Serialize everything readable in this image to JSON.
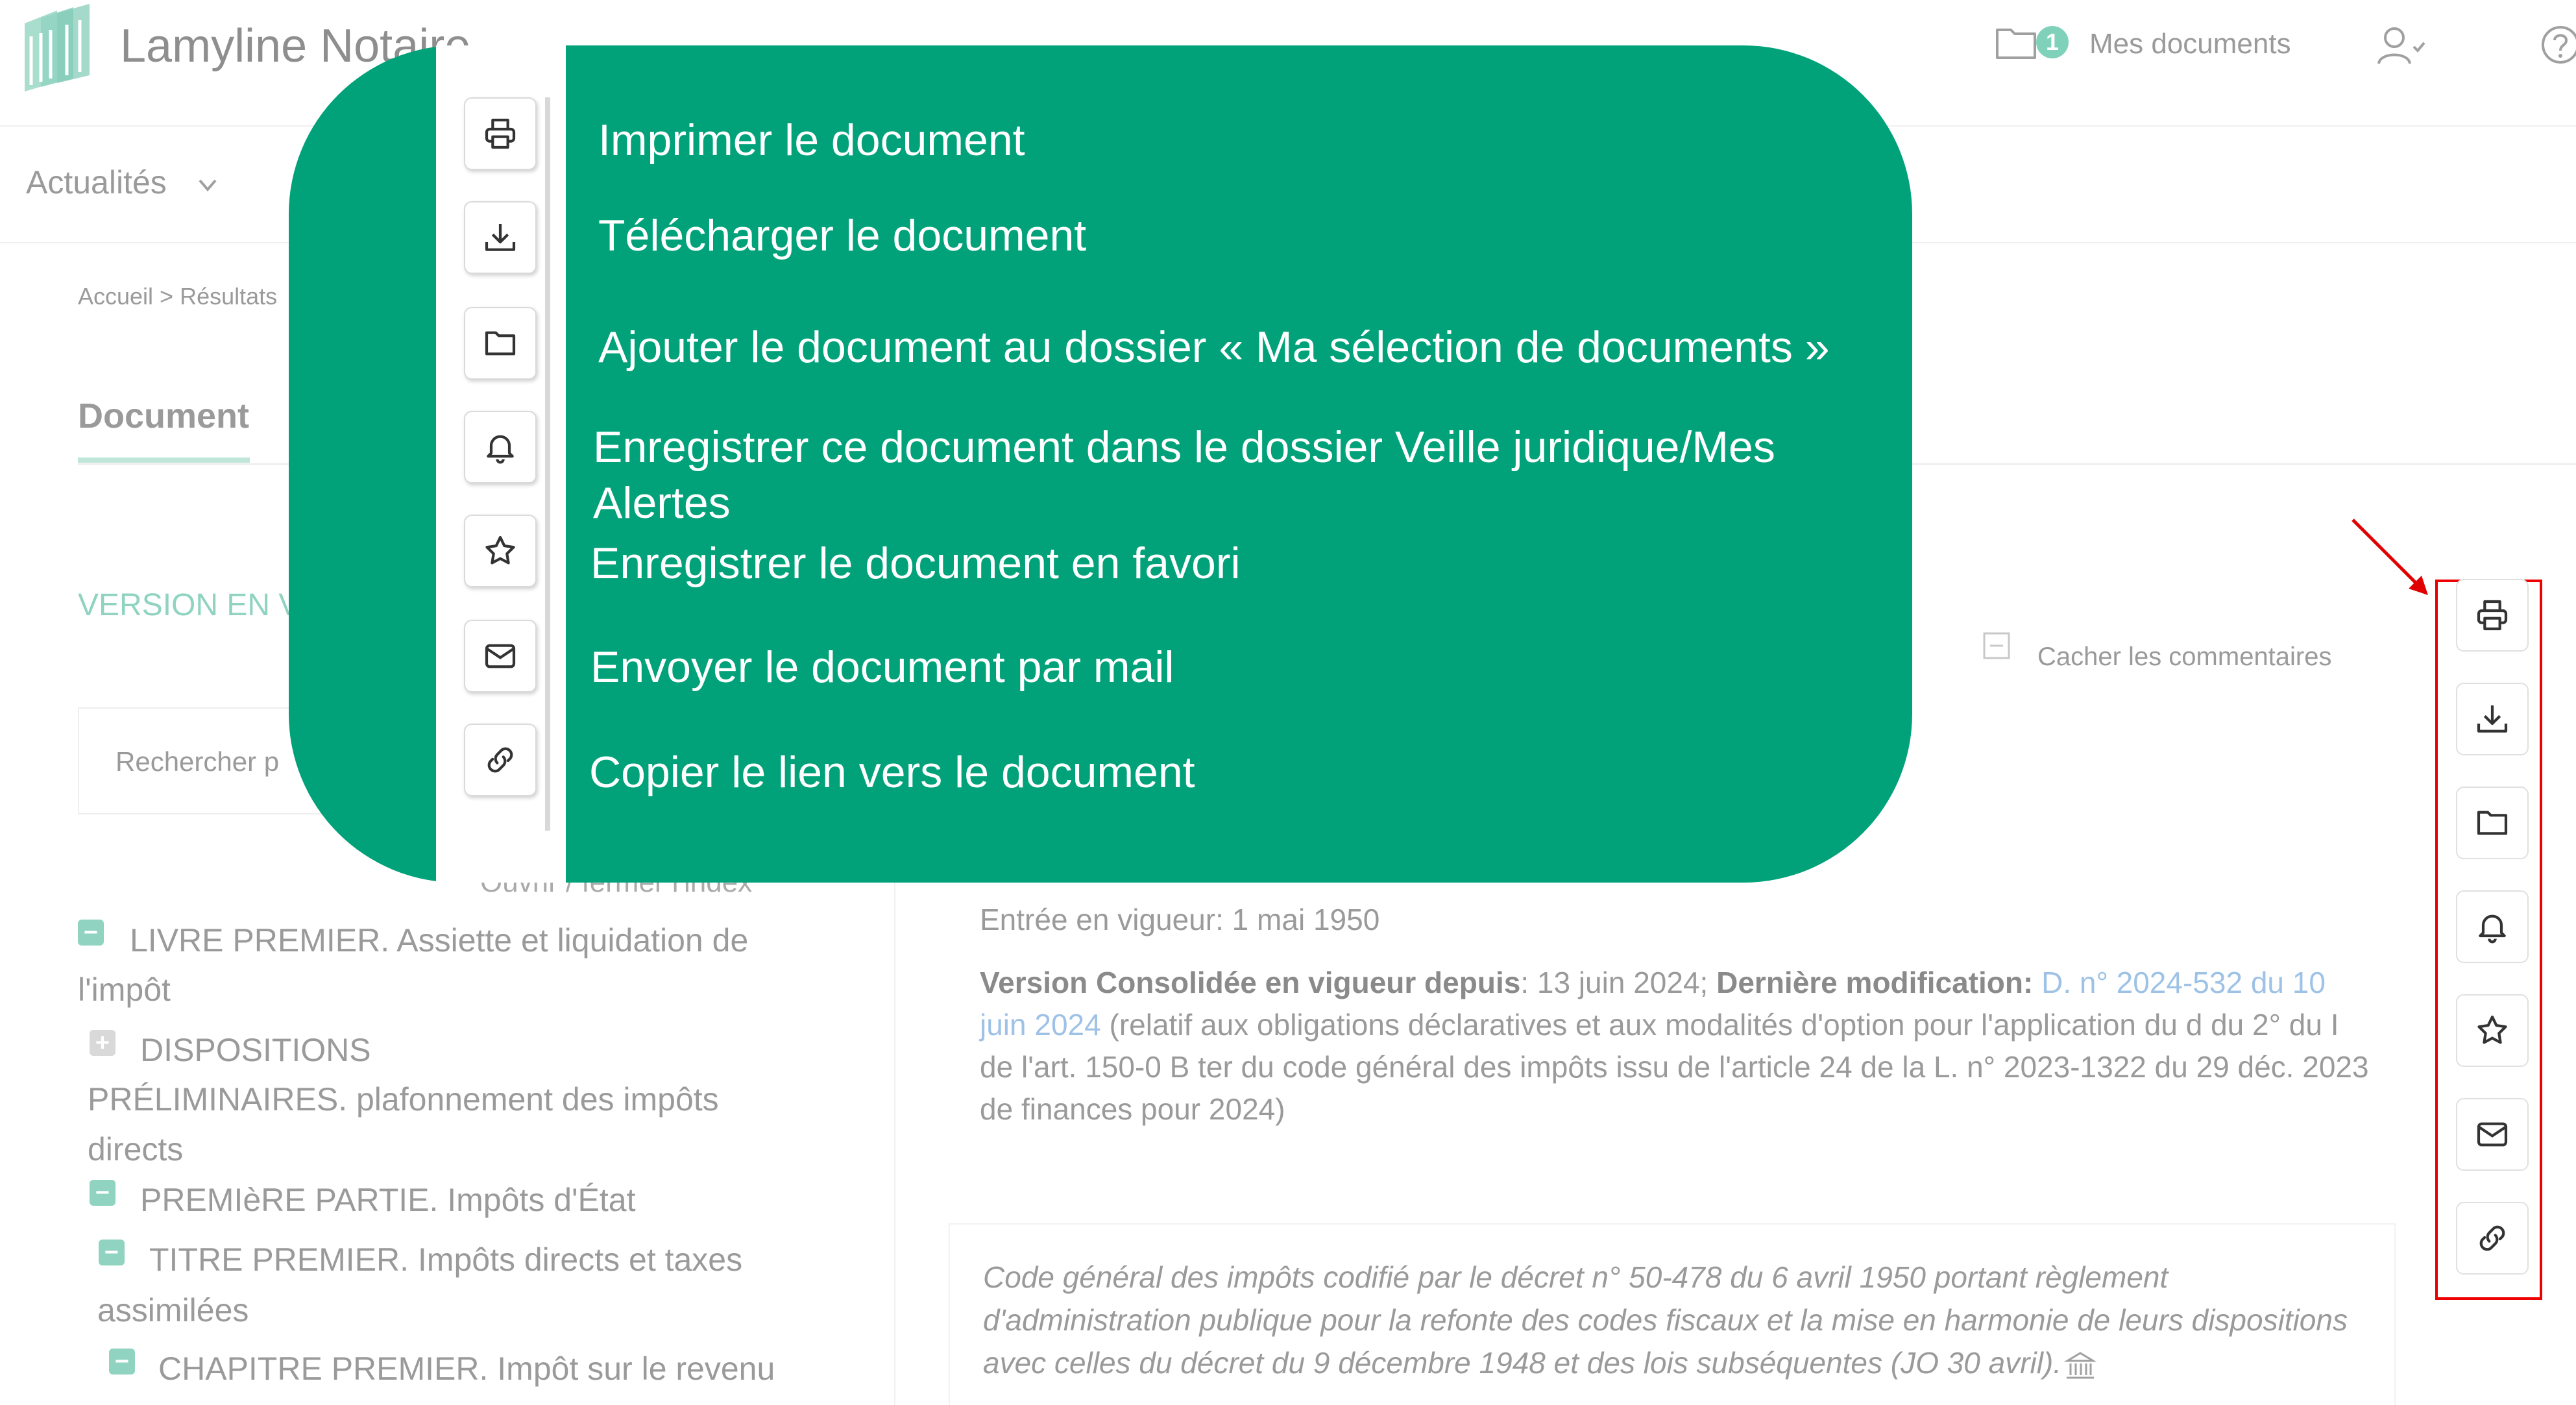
{
  "header": {
    "app_name": "Lamyline Notaire",
    "documents_count": "1",
    "documents_label": "Mes documents"
  },
  "nav": {
    "news_label": "Actualités"
  },
  "breadcrumb": "Accueil > Résultats",
  "tabs": {
    "document": "Document"
  },
  "left": {
    "version_label": "VERSION EN V",
    "search_placeholder": "Rechercher p",
    "index_toggle": "Ouvrir / fermer l'index",
    "tree": [
      {
        "symbol": "−",
        "lines": [
          "LIVRE PREMIER. Assiette et liquidation de",
          "l'impôt"
        ]
      },
      {
        "symbol": "+",
        "lines": [
          "DISPOSITIONS",
          "PRÉLIMINAIRES. plafonnement des impôts",
          "directs"
        ]
      },
      {
        "symbol": "−",
        "lines": [
          "PREMIèRE PARTIE. Impôts d'État"
        ]
      },
      {
        "symbol": "−",
        "lines": [
          "TITRE PREMIER. Impôts directs et taxes",
          "assimilées"
        ]
      },
      {
        "symbol": "−",
        "lines": [
          "CHAPITRE PREMIER. Impôt sur le revenu"
        ]
      }
    ]
  },
  "content": {
    "hide_comments": "Cacher les commentaires",
    "in_force_date": "Entrée en vigueur: 1 mai 1950",
    "consolidated_label": "Version Consolidée en vigueur depuis",
    "consolidated_date": ": 13 juin 2024;",
    "last_modification_label": "Dernière modification:",
    "last_modification_link": "D. n° 2024-532 du 10 juin 2024",
    "last_modification_detail": "(relatif aux obligations déclaratives et aux modalités d'option pour l'application du d du 2° du I de l'art. 150-0 B ter du code général des impôts issu de l'article 24 de la L. n° 2023-1322 du 29 déc. 2023 de finances pour 2024)",
    "comment_text": "Code général des impôts codifié par le décret n° 50-478 du 6 avril 1950 portant règlement d'administration publique pour la refonte des codes fiscaux et la mise en harmonie de leurs dispositions avec celles du décret du 9 décembre 1948 et des lois subséquentes (JO 30 avril)."
  },
  "toolbar_icons": [
    "print-icon",
    "download-icon",
    "folder-icon",
    "bell-icon",
    "star-icon",
    "mail-icon",
    "link-icon"
  ],
  "callout": {
    "items": [
      "Imprimer le document",
      "Télécharger le document",
      "Ajouter le document au dossier « Ma sélection de documents »",
      "Enregistrer ce document dans le dossier Veille juridique/Mes Alertes",
      "Enregistrer le document en favori",
      "Envoyer le document par mail",
      "Copier le lien vers le document"
    ]
  },
  "colors": {
    "callout_green": "#01a27a",
    "accent_mint": "#8fd3c0",
    "highlight_red": "#ee0000",
    "link_blue": "#9ec2e6"
  }
}
